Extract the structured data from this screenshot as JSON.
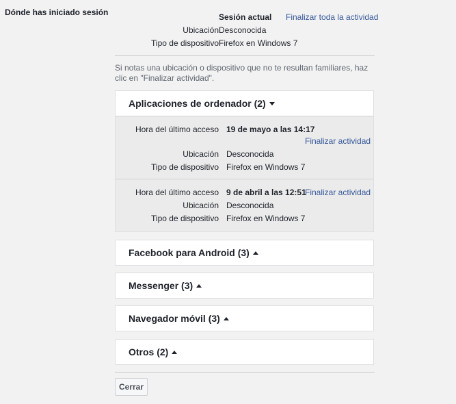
{
  "section_title": "Dónde has iniciado sesión",
  "current_session": {
    "header_label": "Sesión actual",
    "end_all_link": "Finalizar toda la actividad",
    "location_label": "Ubicación",
    "location_value": "Desconocida",
    "device_label": "Tipo de dispositivo",
    "device_value": "Firefox en Windows 7"
  },
  "hint": "Si notas una ubicación o dispositivo que no te resultan familiares, haz clic en \"Finalizar actividad\".",
  "groups": [
    {
      "title": "Aplicaciones de ordenador (2)",
      "expanded": true,
      "sessions": [
        {
          "last_access_label": "Hora del último acceso",
          "last_access_value": "19 de mayo a las 14:17",
          "end_link": "Finalizar actividad",
          "location_label": "Ubicación",
          "location_value": "Desconocida",
          "device_label": "Tipo de dispositivo",
          "device_value": "Firefox en Windows 7"
        },
        {
          "last_access_label": "Hora del último acceso",
          "last_access_value": "9 de abril a las 12:51",
          "end_link": "Finalizar actividad",
          "location_label": "Ubicación",
          "location_value": "Desconocida",
          "device_label": "Tipo de dispositivo",
          "device_value": "Firefox en Windows 7"
        }
      ]
    },
    {
      "title": "Facebook para Android (3)",
      "expanded": false
    },
    {
      "title": "Messenger (3)",
      "expanded": false
    },
    {
      "title": "Navegador móvil (3)",
      "expanded": false
    },
    {
      "title": "Otros (2)",
      "expanded": false
    }
  ],
  "close_button": "Cerrar",
  "colors": {
    "link": "#365899",
    "panel": "#ebebeb",
    "border": "#dddfe2"
  }
}
